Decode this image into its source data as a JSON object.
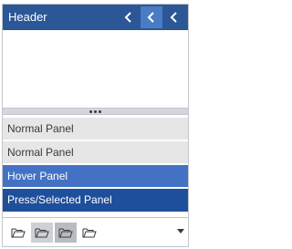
{
  "header": {
    "title": "Header",
    "buttons": [
      {
        "icon": "chevron-left-icon"
      },
      {
        "icon": "chevron-left-icon",
        "state": "hover"
      },
      {
        "icon": "chevron-left-icon",
        "state": "pressed"
      }
    ]
  },
  "panels": [
    {
      "label": "Normal Panel",
      "state": "normal"
    },
    {
      "label": "Normal Panel",
      "state": "normal"
    },
    {
      "label": "Hover Panel",
      "state": "hover"
    },
    {
      "label": "Press/Selected Panel",
      "state": "pressed"
    }
  ],
  "toolbar": {
    "buttons": [
      {
        "icon": "folder-icon",
        "state": "normal"
      },
      {
        "icon": "folder-icon",
        "state": "hover"
      },
      {
        "icon": "folder-icon",
        "state": "pressed"
      },
      {
        "icon": "folder-icon",
        "state": "normal"
      }
    ],
    "overflow_icon": "dropdown-arrow-icon"
  },
  "colors": {
    "header_bg": "#2b5797",
    "header_hover": "#4a7cc6",
    "panel_normal": "#e6e6e6",
    "panel_hover": "#4372c4",
    "panel_pressed": "#1e4f9b"
  }
}
